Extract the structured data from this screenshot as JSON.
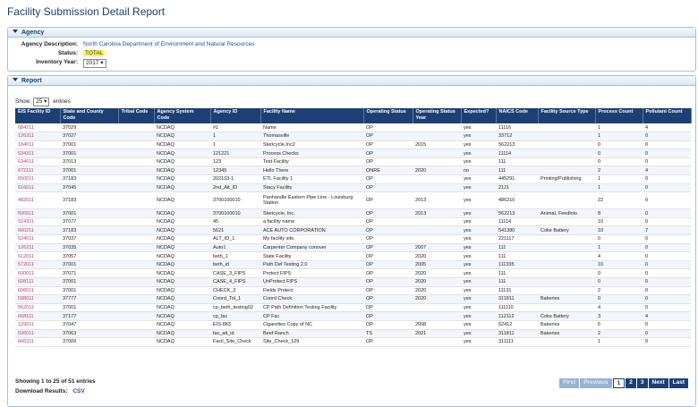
{
  "page": {
    "title": "Facility Submission Detail Report"
  },
  "agency": {
    "section_label": "Agency",
    "description_label": "Agency Description:",
    "description_value": "North Carolina Department of Environment and Natural Resources",
    "status_label": "Status:",
    "status_value": "TOTAL",
    "year_label": "Inventory Year:",
    "year_value": "2017"
  },
  "report": {
    "section_label": "Report",
    "show_label": "Show",
    "page_size": "25",
    "entries_label": "entries",
    "columns": [
      "EIS Facility ID",
      "State and County Code",
      "Tribal Code",
      "Agency System Code",
      "Agency ID",
      "Facility Name",
      "Operating Status",
      "Operating Status Year",
      "Expected?",
      "NAICS Code",
      "Facility Source Type",
      "Process Count",
      "Pollutant Count"
    ],
    "rows": [
      [
        "684211",
        "37029",
        "",
        "NCDAQ",
        "#1",
        "Name",
        "OP",
        "",
        "yes",
        "11116",
        "",
        "1",
        "4"
      ],
      [
        "126311",
        "37027",
        "",
        "NCDAQ",
        "1",
        "Thomasville",
        "OP",
        "",
        "yes",
        "33712",
        "",
        "1",
        "0"
      ],
      [
        "184011",
        "37001",
        "",
        "NCDAQ",
        "1",
        "Stericycle,Inc2",
        "OP",
        "2015",
        "yes",
        "562213",
        "",
        "0",
        "0"
      ],
      [
        "534311",
        "37001",
        "",
        "NCDAQ",
        "121221",
        "Process Checks",
        "OP",
        "",
        "yes",
        "11114",
        "",
        "0",
        "0"
      ],
      [
        "634011",
        "37013",
        "",
        "NCDAQ",
        "123",
        "Test Facility",
        "OP",
        "",
        "yes",
        "111",
        "",
        "0",
        "0"
      ],
      [
        "672111",
        "37001",
        "",
        "NCDAQ",
        "12345",
        "Hello There",
        "ONRE",
        "2020",
        "no",
        "111",
        "",
        "2",
        "4"
      ],
      [
        "650011",
        "37183",
        "",
        "NCDAQ",
        "202103-1",
        "ETL Facility 1",
        "OP",
        "",
        "yes",
        "445291",
        "Printing/Publishing",
        "1",
        "0"
      ],
      [
        "616011",
        "37045",
        "",
        "NCDAQ",
        "2nd_Alt_ID",
        "Stacy Facility",
        "OP",
        "",
        "yes",
        "2121",
        "",
        "1",
        "0"
      ],
      [
        "482011",
        "37183",
        "",
        "NCDAQ",
        "3700100010",
        "Panhandle Eastern Pipe Line - Louisburg Station",
        "OP",
        "2013",
        "yes",
        "486210",
        "",
        "22",
        "0"
      ],
      [
        "500011",
        "37001",
        "",
        "NCDAQ",
        "3700100010",
        "Stericycle, Inc.",
        "OP",
        "2013",
        "yes",
        "562213",
        "Animal, Feedlots",
        "8",
        "0"
      ],
      [
        "524311",
        "37077",
        "",
        "NCDAQ",
        "45",
        "a facility name",
        "OP",
        "",
        "yes",
        "11114",
        "",
        "10",
        "0"
      ],
      [
        "660211",
        "37183",
        "",
        "NCDAQ",
        "5621",
        "ACE AUTO CORPORATION",
        "OP",
        "",
        "yes",
        "541380",
        "Coke Battery",
        "10",
        "7"
      ],
      [
        "524011",
        "37037",
        "",
        "NCDAQ",
        "ALT_ID_1",
        "My facility site.",
        "OP",
        "",
        "yes",
        "221117",
        "",
        "0",
        "0"
      ],
      [
        "126211",
        "37035",
        "",
        "NCDAQ",
        "Auto1",
        "Carpenter Company conover",
        "OP",
        "2007",
        "yes",
        "111",
        "",
        "1",
        "0"
      ],
      [
        "612011",
        "37057",
        "",
        "NCDAQ",
        "beth_1",
        "State Facility",
        "OP",
        "2020",
        "yes",
        "111",
        "",
        "4",
        "0"
      ],
      [
        "572011",
        "37001",
        "",
        "NCDAQ",
        "beth_id",
        "Path Def Testing 2.0",
        "OP",
        "2005",
        "yes",
        "111335",
        "",
        "10",
        "0"
      ],
      [
        "600011",
        "37071",
        "",
        "NCDAQ",
        "CASE_3_FIPS",
        "Protect FIPS",
        "OP",
        "2020",
        "yes",
        "111",
        "",
        "0",
        "0"
      ],
      [
        "608111",
        "37001",
        "",
        "NCDAQ",
        "CASE_4_FIPS",
        "UnProtect FIPS",
        "OP",
        "2020",
        "yes",
        "111",
        "",
        "0",
        "0"
      ],
      [
        "606011",
        "37001",
        "",
        "NCDAQ",
        "CHECK_3",
        "Fields Protect",
        "OP",
        "2020",
        "yes",
        "11131",
        "",
        "2",
        "0"
      ],
      [
        "598011",
        "37777",
        "",
        "NCDAQ",
        "Coord_Tol_1",
        "Coord Check",
        "OP",
        "2020",
        "yes",
        "311811",
        "Bakeries",
        "0",
        "0"
      ],
      [
        "562011",
        "37001",
        "",
        "NCDAQ",
        "cp_beth_testing02",
        "CP Path Definition Testing Facility",
        "OP",
        "",
        "yes",
        "111110",
        "",
        "4",
        "0"
      ],
      [
        "668111",
        "37177",
        "",
        "NCDAQ",
        "cp_fac",
        "CP Fac",
        "OP",
        "",
        "yes",
        "112112",
        "Coke Battery",
        "3",
        "4"
      ],
      [
        "129011",
        "37047",
        "",
        "NCDAQ",
        "EIS-883",
        "Cigarettes Copy of NC",
        "OP",
        "2008",
        "yes",
        "52412",
        "Bakeries",
        "5",
        "0"
      ],
      [
        "596011",
        "37063",
        "",
        "NCDAQ",
        "fac_alt_id",
        "Beef Ranch",
        "TS",
        "2021",
        "yes",
        "311811",
        "Bakeries",
        "2",
        "0"
      ],
      [
        "666311",
        "37009",
        "",
        "NCDAQ",
        "Facil_Site_Check",
        "Site_Check_129",
        "OP",
        "",
        "yes",
        "311111",
        "",
        "1",
        "0"
      ]
    ],
    "info": "Showing 1 to 25 of 51 entries",
    "download_label": "Download Results:",
    "csv_label": "CSV",
    "pager": {
      "first": "First",
      "previous": "Previous",
      "p1": "1",
      "p2": "2",
      "p3": "3",
      "next": "Next",
      "last": "Last"
    }
  }
}
